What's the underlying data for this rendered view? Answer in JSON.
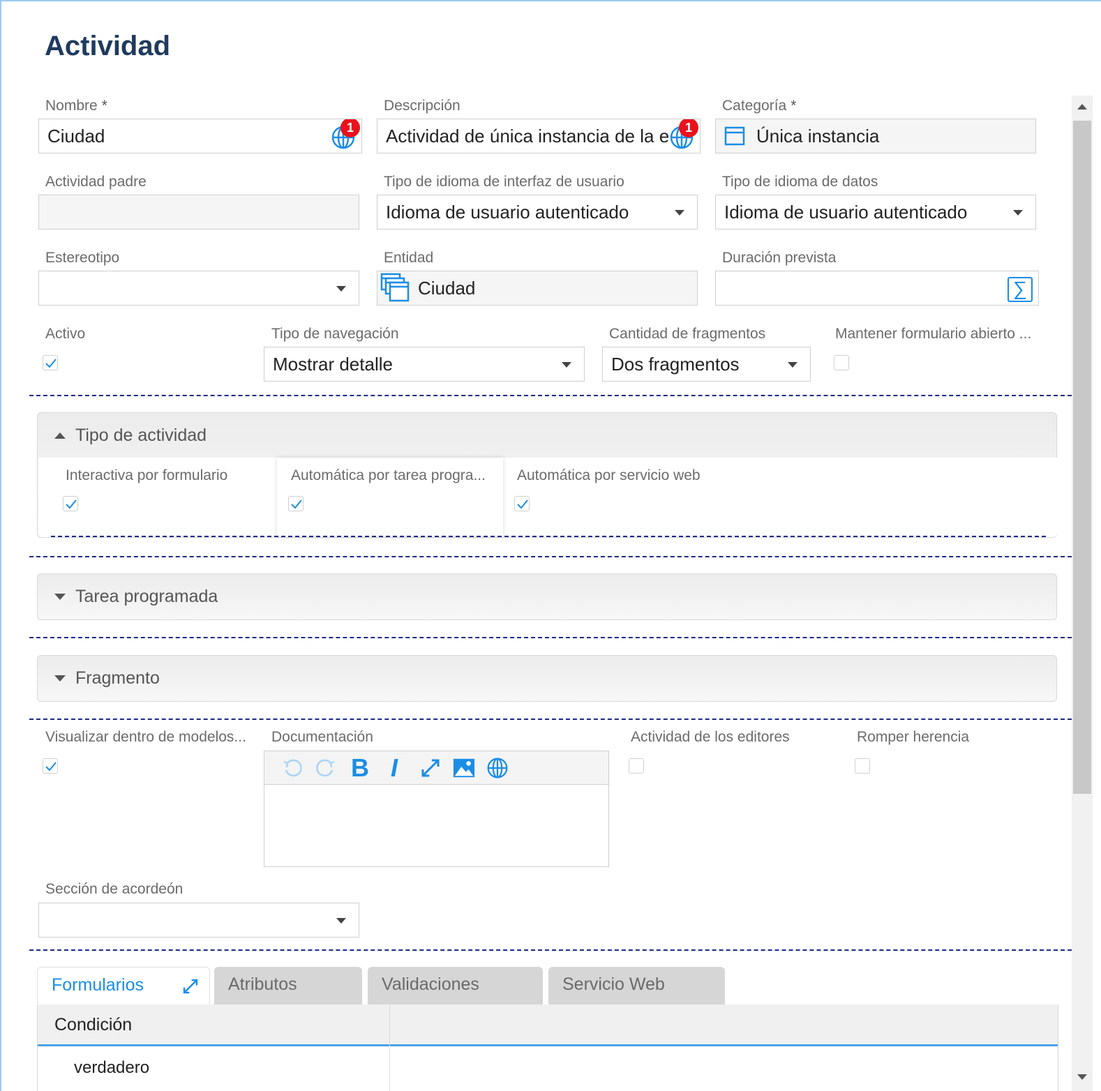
{
  "title": "Actividad",
  "fields": {
    "nombre": {
      "label": "Nombre",
      "required_mark": "*",
      "value": "Ciudad",
      "badge": "1"
    },
    "descripcion": {
      "label": "Descripción",
      "value": "Actividad de única instancia de la e",
      "badge": "1"
    },
    "categoria": {
      "label": "Categoría",
      "required_mark": "*",
      "value": "Única instancia"
    },
    "actividad_padre": {
      "label": "Actividad padre",
      "value": ""
    },
    "tipo_idioma_interfaz": {
      "label": "Tipo de idioma de interfaz de usuario",
      "value": "Idioma de usuario autenticado"
    },
    "tipo_idioma_datos": {
      "label": "Tipo de idioma de datos",
      "value": "Idioma de usuario autenticado"
    },
    "estereotipo": {
      "label": "Estereotipo",
      "value": ""
    },
    "entidad": {
      "label": "Entidad",
      "value": "Ciudad"
    },
    "duracion_prevista": {
      "label": "Duración prevista",
      "value": "",
      "button": "∑"
    },
    "activo": {
      "label": "Activo",
      "checked": true
    },
    "tipo_navegacion": {
      "label": "Tipo de navegación",
      "value": "Mostrar detalle"
    },
    "cantidad_fragmentos": {
      "label": "Cantidad de fragmentos",
      "value": "Dos fragmentos"
    },
    "mantener_formulario": {
      "label": "Mantener formulario abierto ...",
      "checked": false
    }
  },
  "panels": {
    "tipo_actividad": {
      "title": "Tipo de actividad",
      "expanded": true,
      "items": [
        {
          "label": "Interactiva por formulario",
          "checked": true
        },
        {
          "label": "Automática por tarea progra...",
          "checked": true
        },
        {
          "label": "Automática por servicio web",
          "checked": true
        }
      ]
    },
    "tarea_programada": {
      "title": "Tarea programada",
      "expanded": false
    },
    "fragmento": {
      "title": "Fragmento",
      "expanded": false
    }
  },
  "lower": {
    "visualizar": {
      "label": "Visualizar dentro de modelos...",
      "checked": true
    },
    "documentacion": {
      "label": "Documentación",
      "value": ""
    },
    "actividad_editores": {
      "label": "Actividad de los editores",
      "checked": false
    },
    "romper_herencia": {
      "label": "Romper herencia",
      "checked": false
    },
    "seccion_acordeon": {
      "label": "Sección de acordeón",
      "value": ""
    }
  },
  "editor_toolbar": [
    "undo-icon",
    "redo-icon",
    "bold-icon",
    "italic-icon",
    "expand-icon",
    "image-icon",
    "globe-icon"
  ],
  "editor_toolbar_text": {
    "bold": "B",
    "italic": "I"
  },
  "tabs": [
    {
      "label": "Formularios",
      "active": true
    },
    {
      "label": "Atributos",
      "active": false
    },
    {
      "label": "Validaciones",
      "active": false
    },
    {
      "label": "Servicio Web",
      "active": false
    }
  ],
  "grid": {
    "columns": [
      "Condición"
    ],
    "rows": [
      [
        "verdadero"
      ]
    ]
  },
  "colors": {
    "accent": "#1b8de6",
    "title": "#1f3a5f",
    "badge": "#e8121d",
    "dash": "#1a2a8a"
  }
}
